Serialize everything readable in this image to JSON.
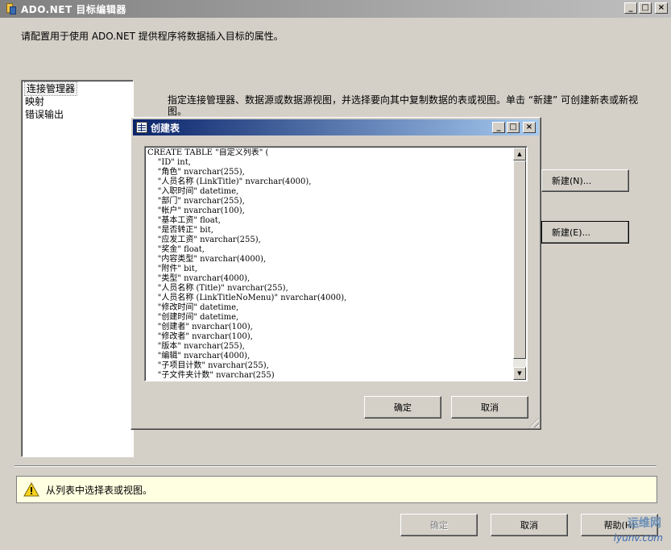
{
  "window": {
    "title": "ADO.NET 目标编辑器",
    "controls": {
      "minimize": "_",
      "maximize": "□",
      "close": "×"
    }
  },
  "description": "请配置用于使用 ADO.NET 提供程序将数据插入目标的属性。",
  "nav": {
    "items": [
      {
        "label": "连接管理器",
        "selected": true
      },
      {
        "label": "映射",
        "selected": false
      },
      {
        "label": "错误输出",
        "selected": false
      }
    ]
  },
  "instruction": "指定连接管理器、数据源或数据源视图，并选择要向其中复制数据的表或视图。单击 “新建” 可创建新表或新视图。",
  "buttons": {
    "new_connection": "新建(N)...",
    "new_table": "新建(E)...",
    "ok": "确定",
    "cancel": "取消",
    "help": "帮助(H)"
  },
  "status": {
    "message": "从列表中选择表或视图。"
  },
  "dialog": {
    "title": "创建表",
    "controls": {
      "minimize": "_",
      "maximize": "□",
      "close": "×"
    },
    "sql": "CREATE TABLE \"自定义列表\" (\n    \"ID\" int,\n    \"角色\" nvarchar(255),\n    \"人员名称 (LinkTitle)\" nvarchar(4000),\n    \"入职时间\" datetime,\n    \"部门\" nvarchar(255),\n    \"帐户\" nvarchar(100),\n    \"基本工资\" float,\n    \"是否转正\" bit,\n    \"应发工资\" nvarchar(255),\n    \"奖金\" float,\n    \"内容类型\" nvarchar(4000),\n    \"附件\" bit,\n    \"类型\" nvarchar(4000),\n    \"人员名称 (Title)\" nvarchar(255),\n    \"人员名称 (LinkTitleNoMenu)\" nvarchar(4000),\n    \"修改时间\" datetime,\n    \"创建时间\" datetime,\n    \"创建者\" nvarchar(100),\n    \"修改者\" nvarchar(100),\n    \"版本\" nvarchar(255),\n    \"编辑\" nvarchar(4000),\n    \"子项目计数\" nvarchar(255),\n    \"子文件夹计数\" nvarchar(255)",
    "buttons": {
      "ok": "确定",
      "cancel": "取消"
    }
  },
  "watermark": {
    "line1": "运维网",
    "line2": "iyunv.com"
  }
}
